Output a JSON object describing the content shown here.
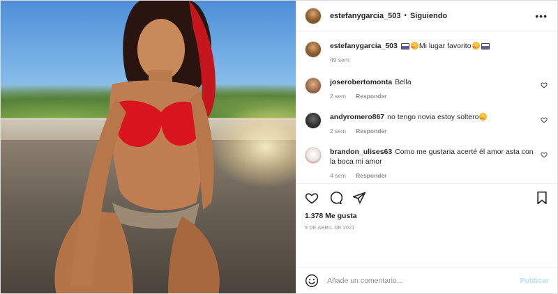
{
  "header": {
    "username": "estefanygarcia_503",
    "separator": "•",
    "follow_status": "Siguiendo",
    "more_icon": "more-horizontal-icon"
  },
  "caption": {
    "username": "estefanygarcia_503",
    "text": "Mi lugar favorito",
    "time": "49 sem"
  },
  "comments": [
    {
      "username": "joserobertomonta",
      "text": "Bella",
      "time": "2 sem",
      "reply": "Responder"
    },
    {
      "username": "andyromero867",
      "text": "no tengo novia estoy soltero",
      "time": "2 sem",
      "reply": "Responder"
    },
    {
      "username": "brandon_ulises63",
      "text": "Como me gustaria acerté él amor asta con la boca mi amor",
      "time": "4 sem",
      "reply": "Responder"
    }
  ],
  "actions": {
    "like_icon": "heart-icon",
    "comment_icon": "comment-icon",
    "share_icon": "share-icon",
    "save_icon": "bookmark-icon",
    "likes": "1.378 Me gusta",
    "date": "9 DE ABRIL DE 2021"
  },
  "add_comment": {
    "placeholder": "Añade un comentario...",
    "post_label": "Publicar",
    "emoji_icon": "emoji-icon"
  },
  "colors": {
    "text": "#262626",
    "muted": "#8e8e8e",
    "border": "#dbdbdb",
    "post_button_disabled": "#b2dffc"
  }
}
